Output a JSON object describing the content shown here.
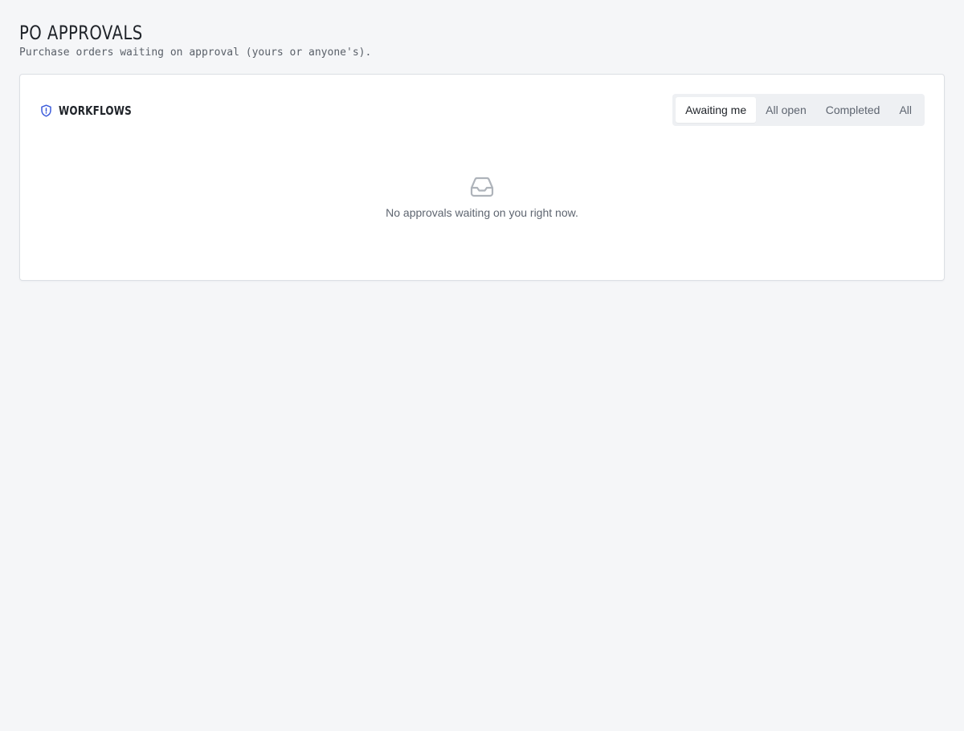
{
  "header": {
    "title": "PO APPROVALS",
    "subtitle": "Purchase orders waiting on approval (yours or anyone's)."
  },
  "workflows": {
    "title": "WORKFLOWS",
    "icon": "shield-icon",
    "tabs": [
      {
        "label": "Awaiting me",
        "active": true
      },
      {
        "label": "All open",
        "active": false
      },
      {
        "label": "Completed",
        "active": false
      },
      {
        "label": "All",
        "active": false
      }
    ],
    "empty_icon": "inbox-icon",
    "empty_message": "No approvals waiting on you right now."
  },
  "colors": {
    "accent": "#3b5bdb",
    "background": "#f5f6f8",
    "muted_icon": "#aeb3ba"
  }
}
